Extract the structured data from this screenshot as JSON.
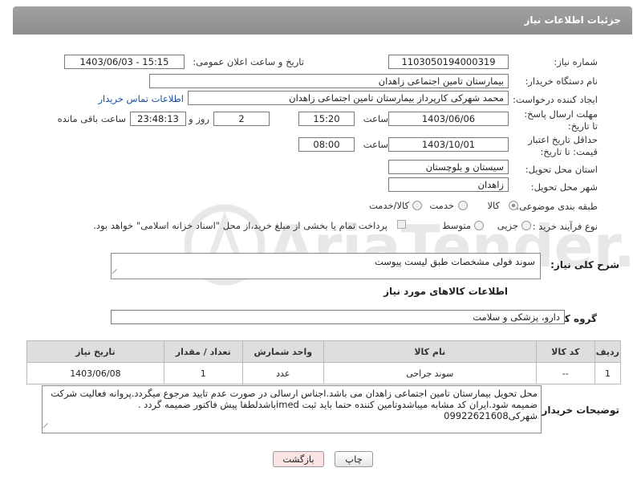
{
  "header": {
    "title": "جزئیات اطلاعات نیاز"
  },
  "form": {
    "need_number_label": "شماره نیاز:",
    "need_number": "1103050194000319",
    "announce_label": "تاریخ و ساعت اعلان عمومی:",
    "announce_value": "1403/06/03 - 15:15",
    "buyer_org_label": "نام دستگاه خریدار:",
    "buyer_org": "بیمارستان تامین اجتماعی زاهدان",
    "creator_label": "ایجاد کننده درخواست:",
    "creator": "محمد شهرکی کارپرداز بیمارستان تامین اجتماعی زاهدان",
    "contact_link": "اطلاعات تماس خریدار",
    "deadline_label": "مهلت ارسال پاسخ: تا تاریخ:",
    "deadline_date": "1403/06/06",
    "time_label": "ساعت",
    "deadline_time": "15:20",
    "days_value": "2",
    "days_label": "روز و",
    "remaining_time": "23:48:13",
    "remaining_label": "ساعت باقی مانده",
    "validity_label": "حداقل تاریخ اعتبار قیمت: تا تاریخ:",
    "validity_date": "1403/10/01",
    "validity_time": "08:00",
    "province_label": "استان محل تحویل:",
    "province": "سیستان و بلوچستان",
    "city_label": "شهر محل تحویل:",
    "city": "زاهدان",
    "category_label": "طبقه بندی موضوعی:",
    "cat_goods": "کالا",
    "cat_service": "خدمت",
    "cat_both": "کالا/خدمت",
    "purchase_label": "نوع فرآیند خرید :",
    "purchase_partial": "جزیی",
    "purchase_medium": "متوسط",
    "purchase_note": "پرداخت تمام یا بخشی از مبلغ خرید،از محل \"اسناد خزانه اسلامی\" خواهد بود."
  },
  "summary": {
    "label": "شرح کلی نیاز:",
    "value": "سوند فولی مشخصات طبق لیست پیوست"
  },
  "goods_section": {
    "title": "اطلاعات کالاهای مورد نیاز"
  },
  "goods_group": {
    "label": "گروه کالا:",
    "value": "دارو، پزشکی و سلامت"
  },
  "table": {
    "headers": [
      "ردیف",
      "کد کالا",
      "نام کالا",
      "واحد شمارش",
      "تعداد / مقدار",
      "تاریخ نیاز"
    ],
    "rows": [
      [
        "1",
        "--",
        "سوند جراحی",
        "عدد",
        "1",
        "1403/06/08"
      ]
    ]
  },
  "buyer_notes": {
    "label": "توضیحات خریدار:",
    "value": "محل تحویل بیمارستان تامین اجتماعی زاهدان می باشد.اجناس ارسالی در صورت عدم تایید مرجوع میگردد.پروانه فعالیت شرکت ضمیمه شود.ایران کد مشابه میباشدوتامین کننده حتما باید ثبت imedباشدلطفا پیش فاکتور ضمیمه گردد . شهرکی09922621608"
  },
  "buttons": {
    "print": "چاپ",
    "back": "بازگشت"
  },
  "watermark": {
    "text": "AriaTender.neT"
  },
  "colors": {
    "header": "#999999",
    "link": "#1a4fa0",
    "back_button": "#fbe3e3"
  }
}
